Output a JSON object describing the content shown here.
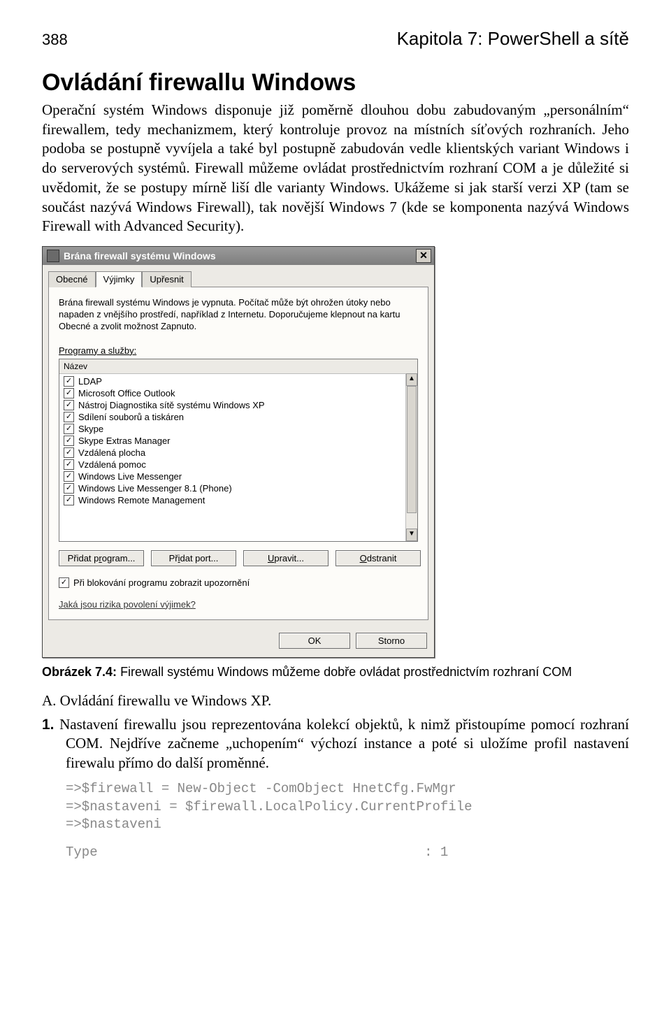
{
  "header": {
    "page_number": "388",
    "chapter": "Kapitola 7: PowerShell a sítě"
  },
  "section_title": "Ovládání firewallu Windows",
  "paragraph1": "Operační systém Windows disponuje již poměrně dlouhou dobu zabudovaným „personálním“ firewallem, tedy mechanizmem, který kontroluje provoz na místních síťových rozhraních. Jeho podoba se postupně vyvíjela a také byl postupně zabudován vedle klientských variant Windows i do serverových systémů. Firewall můžeme ovládat prostřednictvím rozhraní COM a je důležité si uvědomit, že se postupy mírně liší dle varianty Windows. Ukážeme si jak starší verzi XP (tam se součást nazývá Windows Firewall), tak novější Windows 7 (kde se komponenta nazývá Windows Firewall with Advanced Security).",
  "dialog": {
    "title": "Brána firewall systému Windows",
    "tabs": {
      "t1": "Obecné",
      "t2": "Výjimky",
      "t3": "Upřesnit"
    },
    "panel_text": "Brána firewall systému Windows je vypnuta. Počítač může být ohrožen útoky nebo napaden z vnějšího prostředí, například z Internetu. Doporučujeme klepnout na kartu Obecné a zvolit možnost Zapnuto.",
    "list_label": "Programy a služby:",
    "list_header": "Název",
    "items": [
      "LDAP",
      "Microsoft Office Outlook",
      "Nástroj Diagnostika sítě systému Windows XP",
      "Sdílení souborů a tiskáren",
      "Skype",
      "Skype Extras Manager",
      "Vzdálená plocha",
      "Vzdálená pomoc",
      "Windows Live Messenger",
      "Windows Live Messenger 8.1 (Phone)",
      "Windows Remote Management"
    ],
    "buttons": {
      "add_program": "Přidat program...",
      "add_program_u": "r",
      "add_port": "Přidat port...",
      "add_port_u": "i",
      "edit": "Upravit...",
      "edit_u": "U",
      "delete": "Odstranit",
      "delete_u": "O"
    },
    "notify_chk": "Při blokování programu zobrazit upozornění",
    "risks_link": "Jaká jsou rizika povolení výjimek?",
    "ok": "OK",
    "cancel": "Storno"
  },
  "caption_label": "Obrázek 7.4:",
  "caption_text": " Firewall systému Windows můžeme dobře ovládat prostřednictvím rozhraní COM",
  "subsection": "A. Ovládání firewallu ve Windows XP.",
  "step1_num": "1.",
  "step1_text": "  Nastavení firewallu jsou reprezentována kolekcí objektů, k nimž přistoupíme pomocí rozhraní COM. Nejdříve začneme „uchopením“ výchozí instance a poté si uložíme profil nastavení firewalu přímo do další proměnné.",
  "code1": "=>$firewall = New-Object -ComObject HnetCfg.FwMgr\n=>$nastaveni = $firewall.LocalPolicy.CurrentProfile\n=>$nastaveni",
  "code2": "Type                                         : 1"
}
